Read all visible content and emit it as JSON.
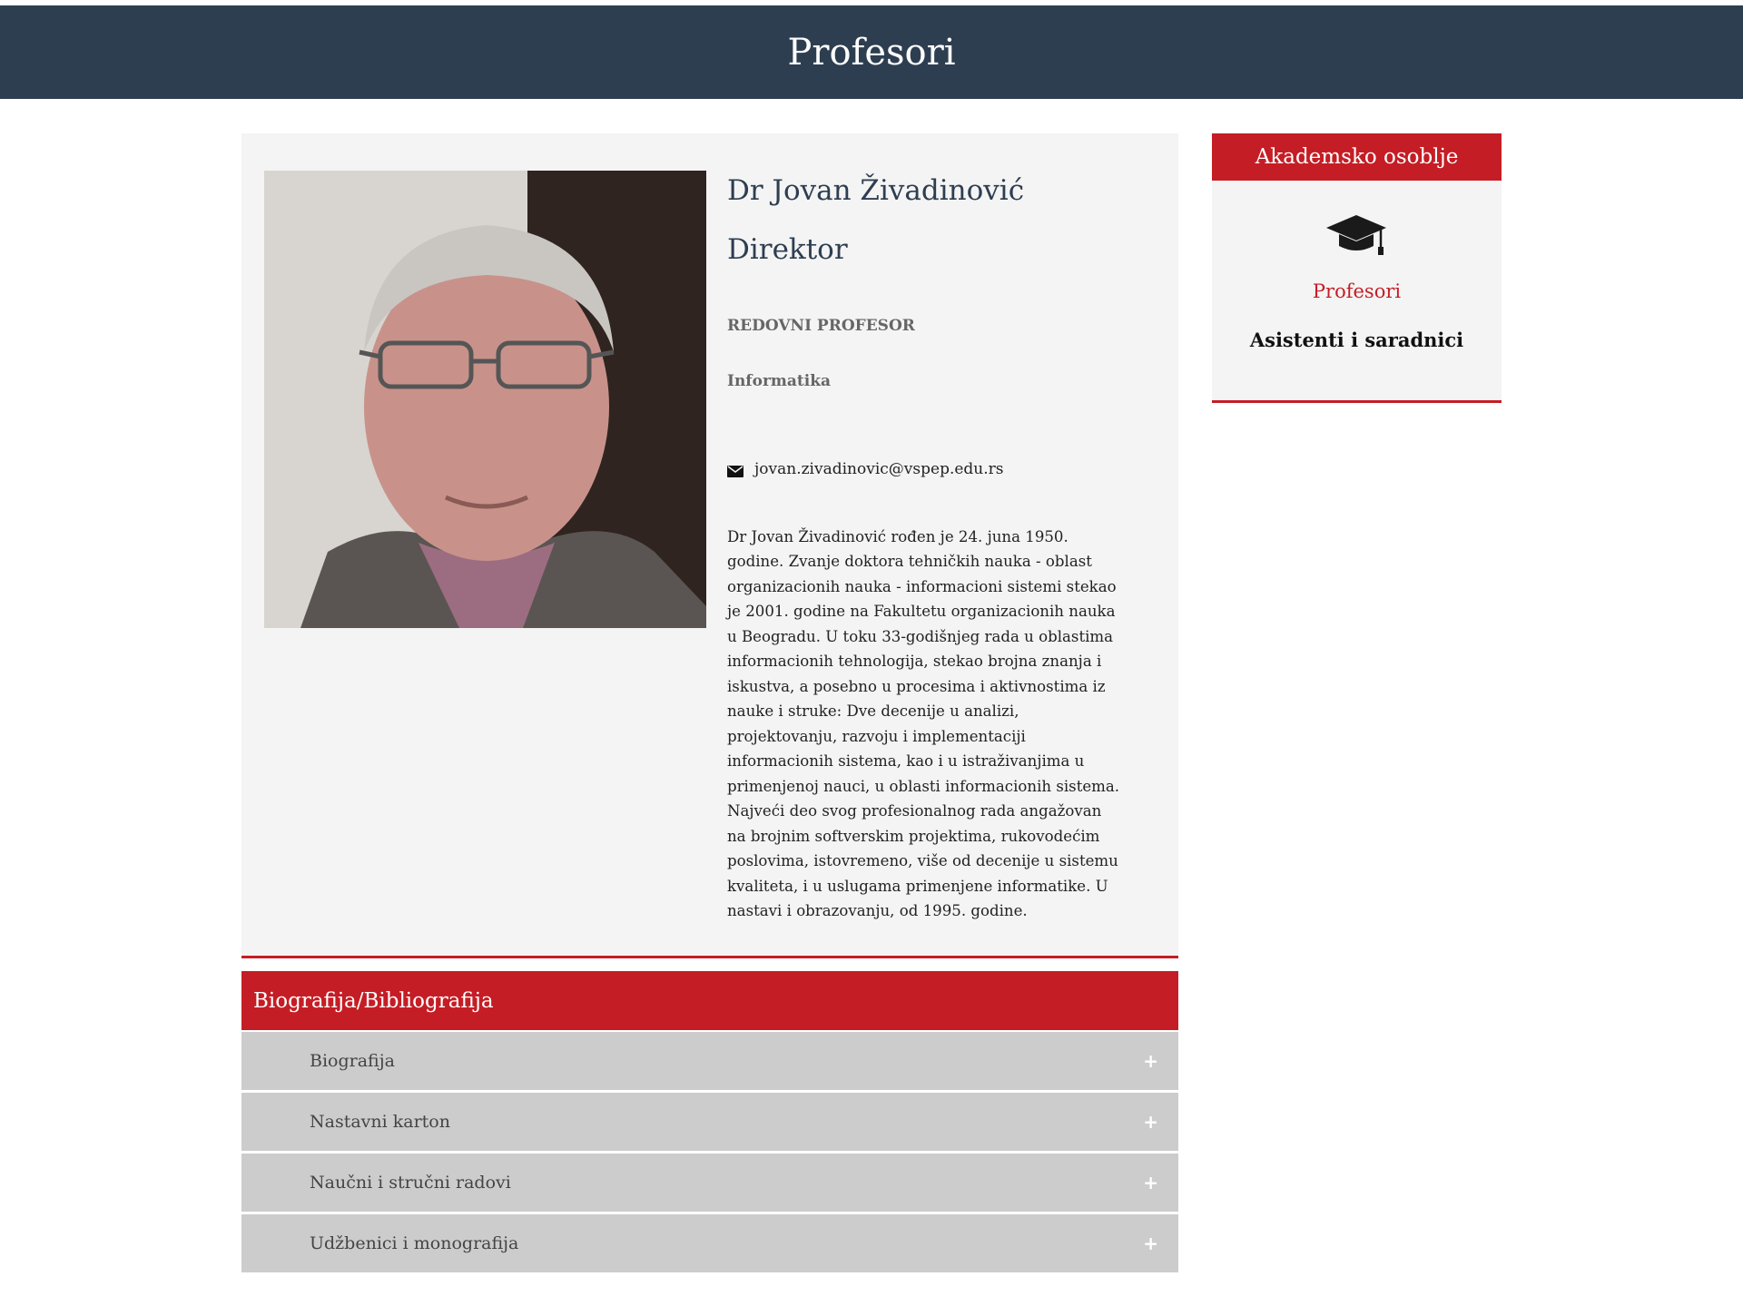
{
  "header": {
    "title": "Profesori"
  },
  "profile": {
    "name": "Dr  Jovan Živadinović",
    "role": "Direktor",
    "rank": "REDOVNI PROFESOR",
    "department": "Informatika",
    "email": "jovan.zivadinovic@vspep.edu.rs",
    "bio": "Dr Jovan Živadinović rođen je 24. juna 1950. godine. Zvanje doktora tehničkih nauka - oblast organizacionih nauka - informacioni sistemi stekao je 2001. godine na Fakultetu organizacionih nauka u Beogradu. U toku 33-godišnjeg rada u oblastima informacionih tehnologija, stekao brojna znanja i iskustva, a posebno u procesima i aktivnostima iz nauke i struke: Dve decenije u analizi, projektovanju, razvoju i implementaciji informacionih sistema, kao i u istraživanjima u primenjenoj nauci, u oblasti informacionih sistema. Najveći deo svog profesionalnog rada angažovan na brojnim softverskim projektima, rukovodećim poslovima, istovremeno, više od decenije u sistemu kvaliteta, i u uslugama primenjene informatike. U nastavi i obrazovanju, od 1995. godine."
  },
  "accordion": {
    "title": "Biografija/Bibliografija",
    "items": [
      {
        "label": "Biografija",
        "icon": "+"
      },
      {
        "label": "Nastavni karton",
        "icon": "+"
      },
      {
        "label": "Naučni i stručni radovi",
        "icon": "+"
      },
      {
        "label": "Udžbenici i monografija",
        "icon": "+"
      }
    ]
  },
  "sidebar": {
    "title": "Akademsko osoblje",
    "icon": "graduation-cap-icon",
    "links": [
      {
        "label": "Profesori",
        "active": true
      },
      {
        "label": "Asistenti i saradnici",
        "active": false
      }
    ]
  },
  "colors": {
    "header_bg": "#2e3e51",
    "accent": "#c51d25",
    "panel_bg": "#f4f4f4",
    "accordion_item_bg": "#cccccc"
  }
}
